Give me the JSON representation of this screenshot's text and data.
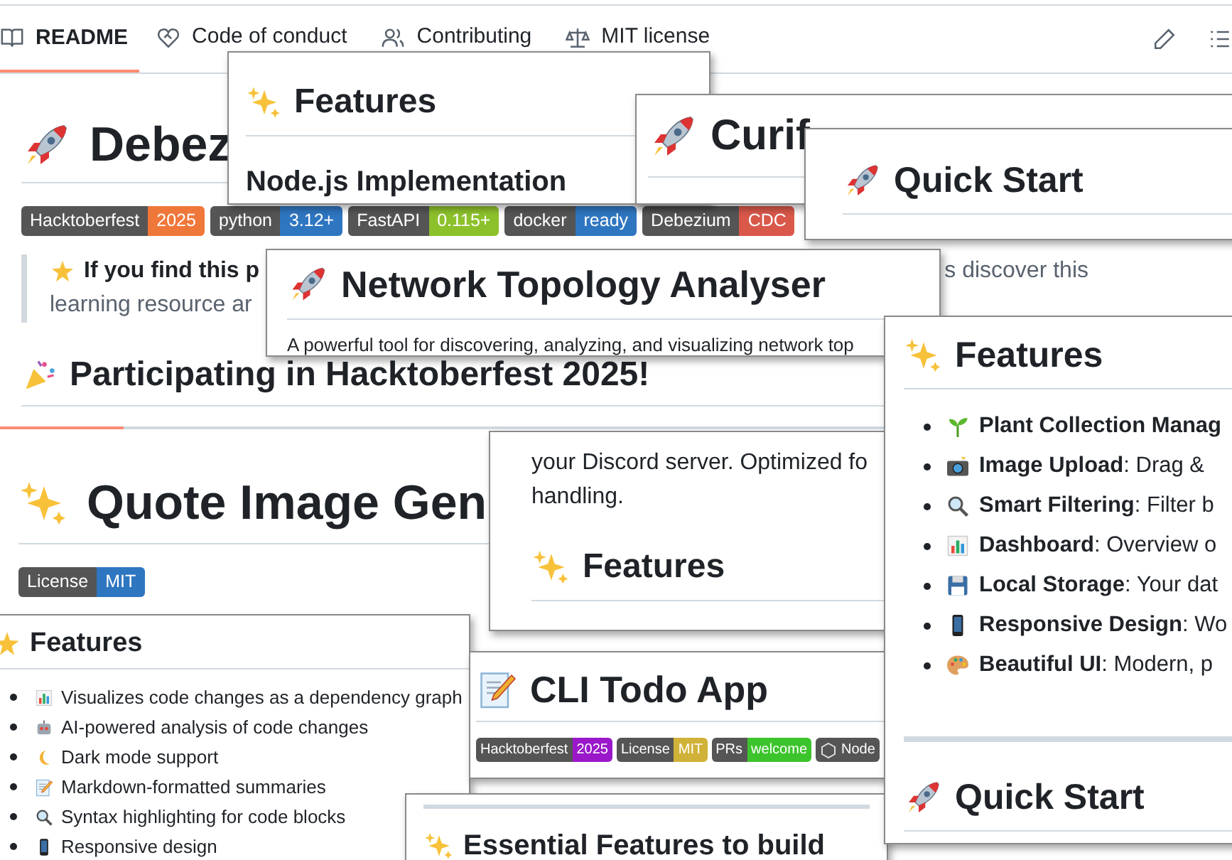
{
  "tabs": [
    {
      "label": "README",
      "selected": true
    },
    {
      "label": "Code of conduct",
      "selected": false
    },
    {
      "label": "Contributing",
      "selected": false
    },
    {
      "label": "MIT license",
      "selected": false
    }
  ],
  "readme": {
    "title": "Debez",
    "badges": [
      {
        "label": "Hacktoberfest",
        "value": "2025",
        "color": "#f0773a"
      },
      {
        "label": "python",
        "value": "3.12+",
        "color": "#2f76c1"
      },
      {
        "label": "FastAPI",
        "value": "0.115+",
        "color": "#8dc12c"
      },
      {
        "label": "docker",
        "value": "ready",
        "color": "#2f76c1"
      },
      {
        "label": "Debezium",
        "value": "CDC",
        "color": "#d9584a"
      }
    ],
    "quote": {
      "lead": "If you find this p",
      "tail": "s discover this",
      "line2": "learning resource ar"
    },
    "hacktoberfest_heading": "Participating in Hacktoberfest 2025!",
    "second_title": "Quote Image Gen",
    "license_badge": {
      "label": "License",
      "value": "MIT",
      "color": "#2f76c1"
    }
  },
  "features_node_card": {
    "heading": "Features",
    "subheading": "Node.js Implementation"
  },
  "curifine_card": {
    "title": "Curif"
  },
  "quick_start_card": {
    "title": "Quick Start"
  },
  "network_card": {
    "title": "Network Topology Analyser",
    "description": "A powerful tool for discovering, analyzing, and visualizing network top"
  },
  "discord_card": {
    "lines": [
      "your Discord server. Optimized fo",
      "handling."
    ],
    "heading": "Features"
  },
  "code_features_card": {
    "heading": "Features",
    "items": [
      "Visualizes code changes as a dependency graph",
      "AI-powered analysis of code changes",
      "Dark mode support",
      "Markdown-formatted summaries",
      "Syntax highlighting for code blocks",
      "Responsive design"
    ]
  },
  "cli_card": {
    "title": "CLI Todo App",
    "badges": [
      {
        "label": "Hacktoberfest",
        "value": "2025",
        "color": "#9a18c9"
      },
      {
        "label": "License",
        "value": "MIT",
        "color": "#d1b238"
      },
      {
        "label": "PRs",
        "value": "welcome",
        "color": "#3cc42c"
      },
      {
        "label": "Node"
      }
    ]
  },
  "essential_card": {
    "heading": "Essential Features to build"
  },
  "plant_card": {
    "heading": "Features",
    "items": [
      {
        "term": "Plant Collection Manag"
      },
      {
        "term": "Image Upload",
        "description": ": Drag &"
      },
      {
        "term": "Smart Filtering",
        "description": ": Filter b"
      },
      {
        "term": "Dashboard",
        "description": ": Overview o"
      },
      {
        "term": "Local Storage",
        "description": ": Your dat"
      },
      {
        "term": "Responsive Design",
        "description": ": Wo"
      },
      {
        "term": "Beautiful UI",
        "description": ": Modern, p"
      }
    ],
    "footer_heading": "Quick Start"
  }
}
